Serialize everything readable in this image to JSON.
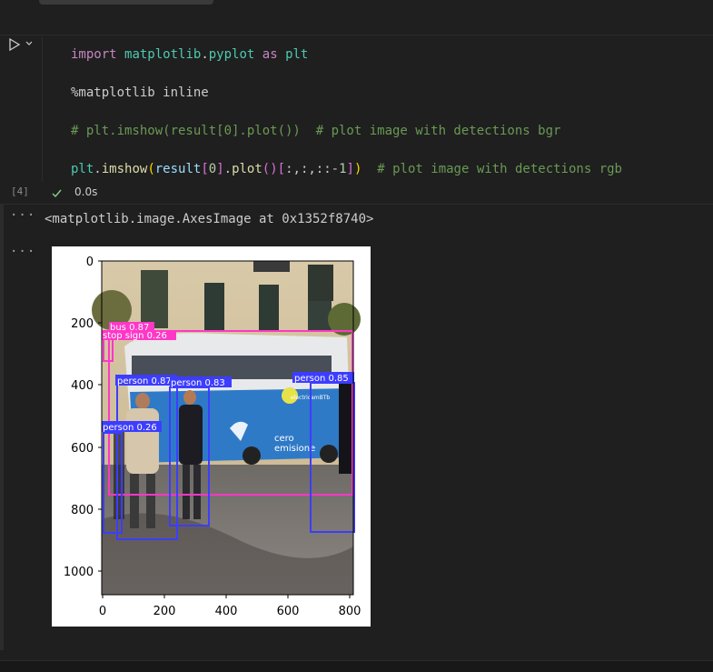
{
  "cell": {
    "execution_count": "[4]",
    "status": "0.0s",
    "code": {
      "line1": {
        "kw1": "import",
        "mod1": "matplotlib",
        "dot": ".",
        "mod2": "pyplot",
        "kw2": "as",
        "alias": "plt"
      },
      "line2": "%matplotlib inline",
      "line3": "# plt.imshow(result[0].plot())  # plot image with detections bgr",
      "line4": {
        "obj": "plt",
        "dot1": ".",
        "fn": "imshow",
        "p1": "(",
        "arg": "result",
        "b1": "[",
        "idx": "0",
        "b2": "]",
        "dot2": ".",
        "fn2": "plot",
        "p2": "()",
        "b3": "[",
        "slice": ":,:,::",
        "neg": "-1",
        "b4": "]",
        "p3": ")",
        "comment": "  # plot image with detections rgb"
      }
    }
  },
  "output": {
    "text": "<matplotlib.image.AxesImage at 0x1352f8740>",
    "figure": {
      "yticks": [
        "0",
        "200",
        "400",
        "600",
        "800",
        "1000"
      ],
      "xticks": [
        "0",
        "200",
        "400",
        "600",
        "800"
      ],
      "detections": [
        {
          "label": "bus 0.87",
          "color": "#ff37c7"
        },
        {
          "label": "stop sign 0.26",
          "color": "#ff37c7"
        },
        {
          "label": "person 0.87",
          "color": "#3d3dff"
        },
        {
          "label": "person 0.83",
          "color": "#3d3dff"
        },
        {
          "label": "person 0.85",
          "color": "#3d3dff"
        },
        {
          "label": "person 0.26",
          "color": "#3d3dff"
        }
      ],
      "scene_text": {
        "brand": "electricamBTb",
        "cero": "cero",
        "emisione": "emisione"
      }
    }
  },
  "icons": {
    "run": "play-icon",
    "chevron": "chevron-down-icon",
    "check": "check-icon",
    "more": "more-icon"
  }
}
